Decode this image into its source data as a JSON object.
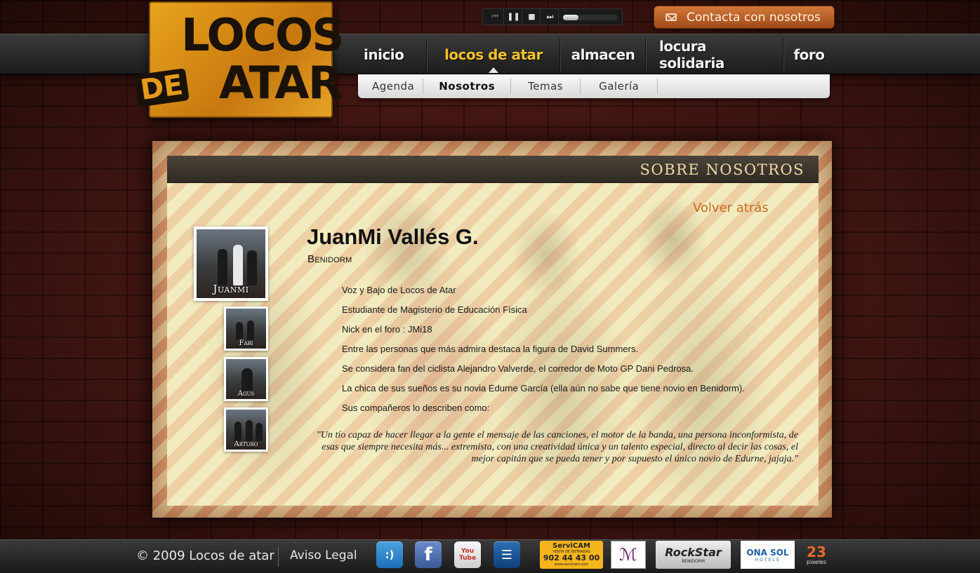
{
  "logo": {
    "line1": "LOCOS",
    "line2": "DE",
    "line3": "ATAR"
  },
  "player": {
    "prev": "⏮",
    "pause": "❚❚",
    "stop": "■",
    "next": "⏭",
    "volume": 0.28
  },
  "contact": {
    "label": "Contacta con nosotros"
  },
  "main_nav": [
    {
      "label": "inicio"
    },
    {
      "label": "locos de atar"
    },
    {
      "label": "almacen"
    },
    {
      "label": "locura solidaria"
    },
    {
      "label": "foro"
    }
  ],
  "sub_nav": [
    {
      "label": "Agenda"
    },
    {
      "label": "Nosotros"
    },
    {
      "label": "Temas"
    },
    {
      "label": "Galería"
    }
  ],
  "section": {
    "title": "SOBRE NOSOTROS",
    "back": "Volver atrás"
  },
  "members": {
    "main": "Juanmi",
    "others": [
      "Fabi",
      "Agus",
      "Arturo"
    ]
  },
  "profile": {
    "name": "JuanMi Vallés G.",
    "city": "Benidorm",
    "facts": [
      "Voz y Bajo de Locos de Atar",
      "Estudiante de Magisterio de Educación Física",
      "Nick en el foro : JMi18",
      "Entre las personas que más admira destaca la figura de David Summers.",
      "Se considera fan del ciclista Alejandro Valverde, el corredor de Moto GP Dani Pedrosa.",
      "La chica de sus sueños es su novia Edurne García (ella aún no sabe que tiene novio en Benidorm).",
      "Sus compañeros lo describen como:"
    ],
    "quote": "\"Un tío capaz de hacer llegar a la gente el mensaje de las canciones, el motor de la banda, una persona inconformista, de esas que siempre necesita más... extremista, con una creatividad única y un talento especial, directo al decir las cosas, el mejor capitán que se pueda tener y por supuesto el único novio de Edurne, jajaja.\""
  },
  "footer": {
    "copyright": "© 2009  Locos de atar",
    "legal": "Aviso Legal",
    "social": [
      {
        "name": "tuenti-icon",
        "glyph": ":)"
      },
      {
        "name": "facebook-icon",
        "glyph": "f"
      },
      {
        "name": "youtube-icon",
        "glyph": "You Tube"
      },
      {
        "name": "myspace-icon",
        "glyph": "☰"
      }
    ],
    "sponsors": [
      {
        "line1": "ServiCAM",
        "line2": "VENTA DE ENTRADAS",
        "line3": "902 44 43 00",
        "line4": "www.servicam.com"
      },
      {
        "line1": "ℳ"
      },
      {
        "line1": "RockStar",
        "line2": "BENIDORM"
      },
      {
        "line1": "ONA SOL",
        "line2": "HOTELS"
      },
      {
        "line1": "23",
        "line2": "pixeles"
      }
    ]
  }
}
